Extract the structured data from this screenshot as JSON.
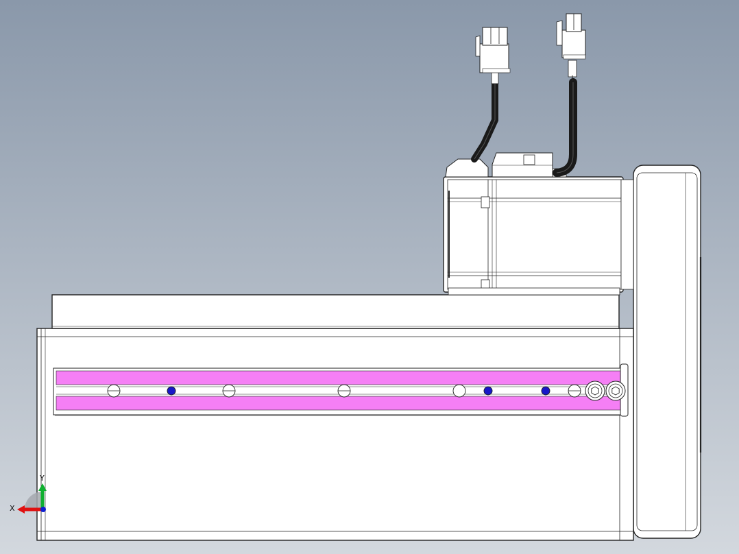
{
  "viewport": {
    "background_top": "#8a98aa",
    "background_bottom": "#d3d8de"
  },
  "part_colors": {
    "body": "#ffffff",
    "outline": "#222222",
    "slot_band": "#f57ff5",
    "blue_hole": "#1818c8",
    "cable": "#1a1a1a"
  },
  "triad": {
    "x_label": "X",
    "y_label": "Y",
    "x_color": "#e01010",
    "y_color": "#10b030",
    "z_color": "#1020d0"
  }
}
